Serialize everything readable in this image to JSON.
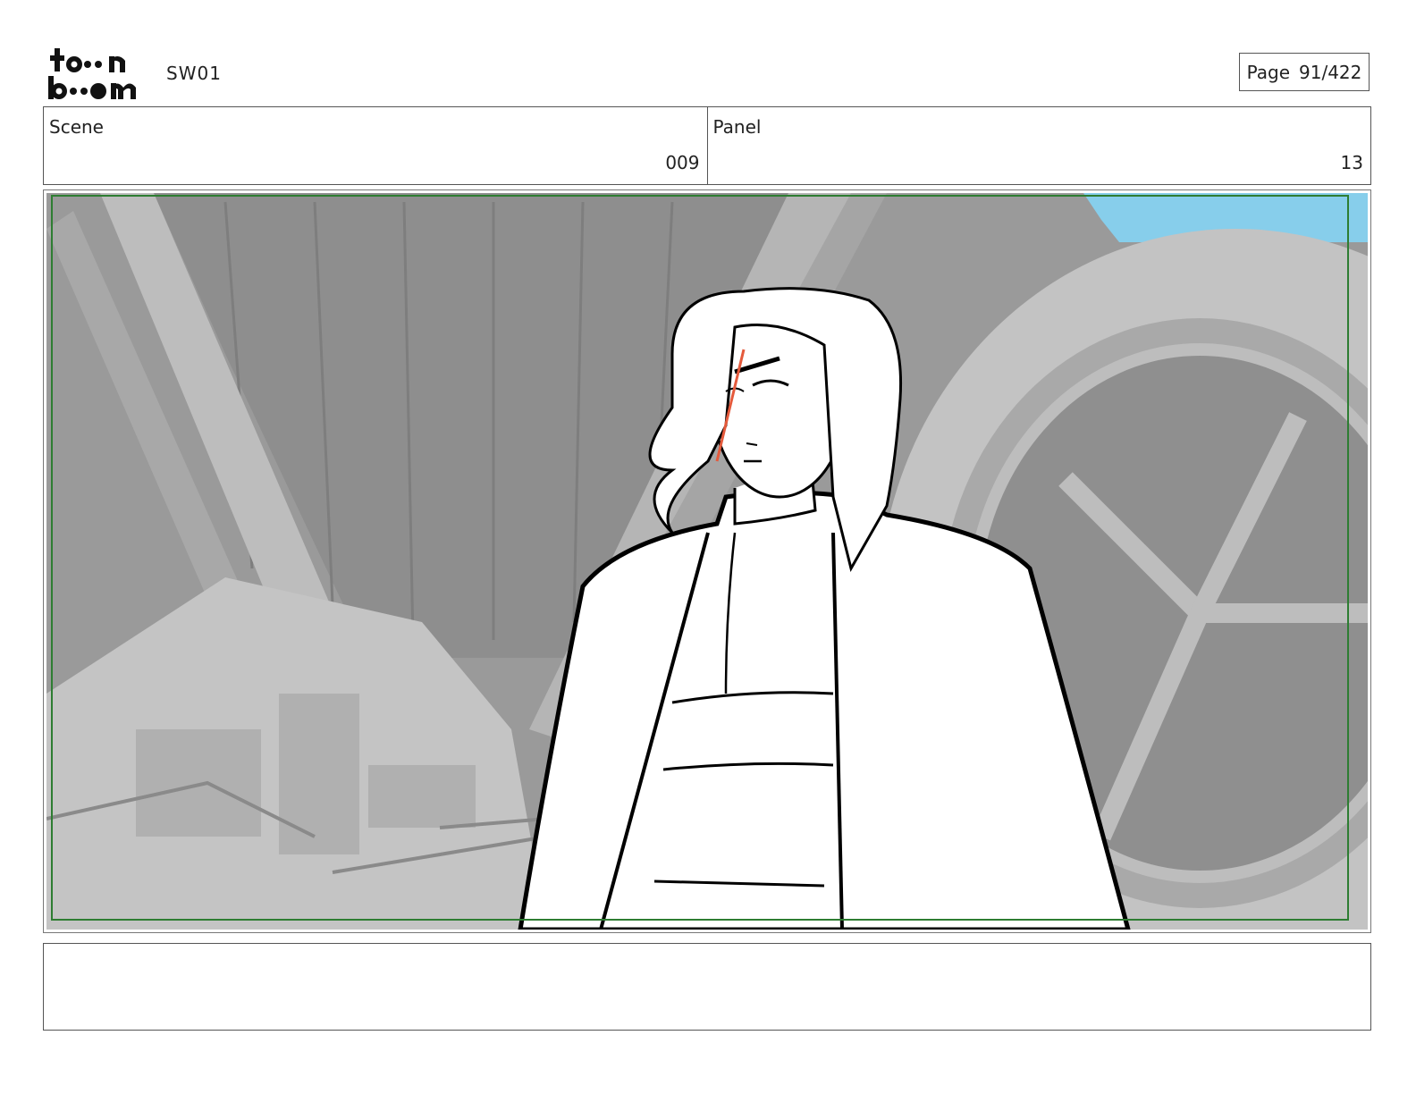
{
  "header": {
    "logo_text": "toonboom",
    "project": "SW01",
    "page_label": "Page",
    "page_value": "91/422"
  },
  "info": {
    "scene_label": "Scene",
    "scene_value": "009",
    "panel_label": "Panel",
    "panel_value": "13"
  },
  "frame": {
    "description_hidden": "",
    "safe_area_color": "#2e7d32",
    "sky_color": "#87ceeb"
  },
  "notes": {
    "text": ""
  }
}
